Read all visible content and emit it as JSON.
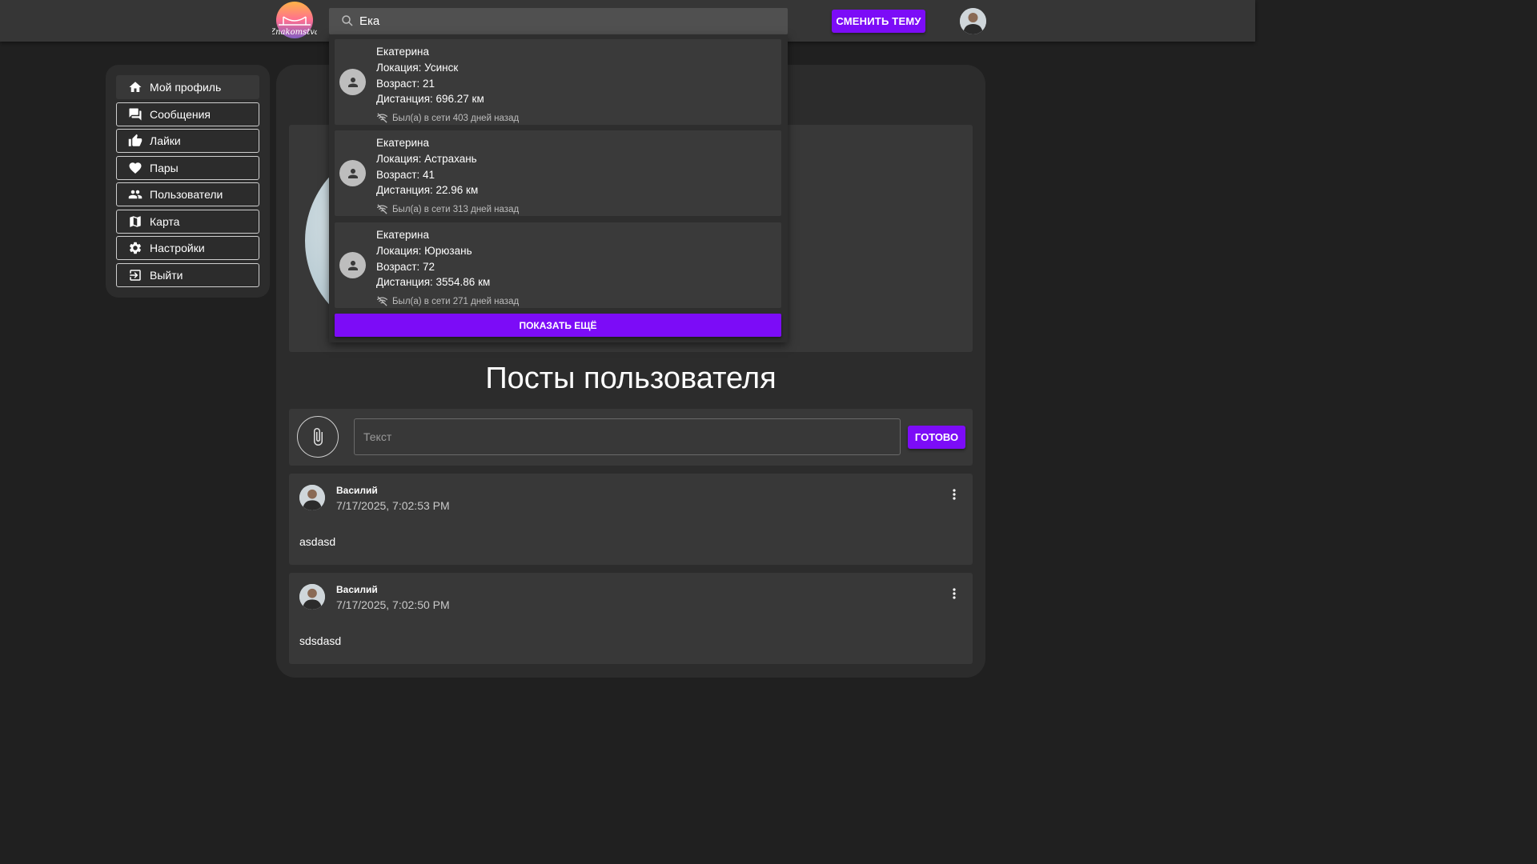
{
  "header": {
    "logo_text": "Znakomstva",
    "search": {
      "value": "Ека",
      "placeholder": ""
    },
    "theme_button": "СМЕНИТЬ ТЕМУ"
  },
  "sidebar": {
    "items": [
      {
        "label": "Мой профиль",
        "icon": "home-icon"
      },
      {
        "label": "Сообщения",
        "icon": "messages-icon"
      },
      {
        "label": "Лайки",
        "icon": "thumb-up-icon"
      },
      {
        "label": "Пары",
        "icon": "heart-icon"
      },
      {
        "label": "Пользователи",
        "icon": "people-icon"
      },
      {
        "label": "Карта",
        "icon": "map-icon"
      },
      {
        "label": "Настройки",
        "icon": "gear-icon"
      },
      {
        "label": "Выйти",
        "icon": "logout-icon"
      }
    ]
  },
  "search_results": [
    {
      "name": "Екатерина",
      "location": "Локация: Усинск",
      "age": "Возраст: 21",
      "distance": "Дистанция: 696.27 км",
      "status": "Был(а) в сети 403 дней назад"
    },
    {
      "name": "Екатерина",
      "location": "Локация: Астрахань",
      "age": "Возраст: 41",
      "distance": "Дистанция: 22.96 км",
      "status": "Был(а) в сети 313 дней назад"
    },
    {
      "name": "Екатерина",
      "location": "Локация: Юрюзань",
      "age": "Возраст: 72",
      "distance": "Дистанция: 3554.86 км",
      "status": "Был(а) в сети 271 дней назад"
    }
  ],
  "show_more_button": "ПОКАЗАТЬ ЕЩЁ",
  "main": {
    "posts_title": "Посты пользователя",
    "composer": {
      "placeholder": "Текст",
      "done_button": "ГОТОВО"
    },
    "posts": [
      {
        "author": "Василий",
        "date": "7/17/2025, 7:02:53 PM",
        "text": "asdasd"
      },
      {
        "author": "Василий",
        "date": "7/17/2025, 7:02:50 PM",
        "text": "sdsdasd"
      }
    ]
  },
  "colors": {
    "accent": "#7c0cf7",
    "background": "#202020",
    "panel": "#2c2c2c",
    "card": "#383838",
    "header": "#363636"
  }
}
